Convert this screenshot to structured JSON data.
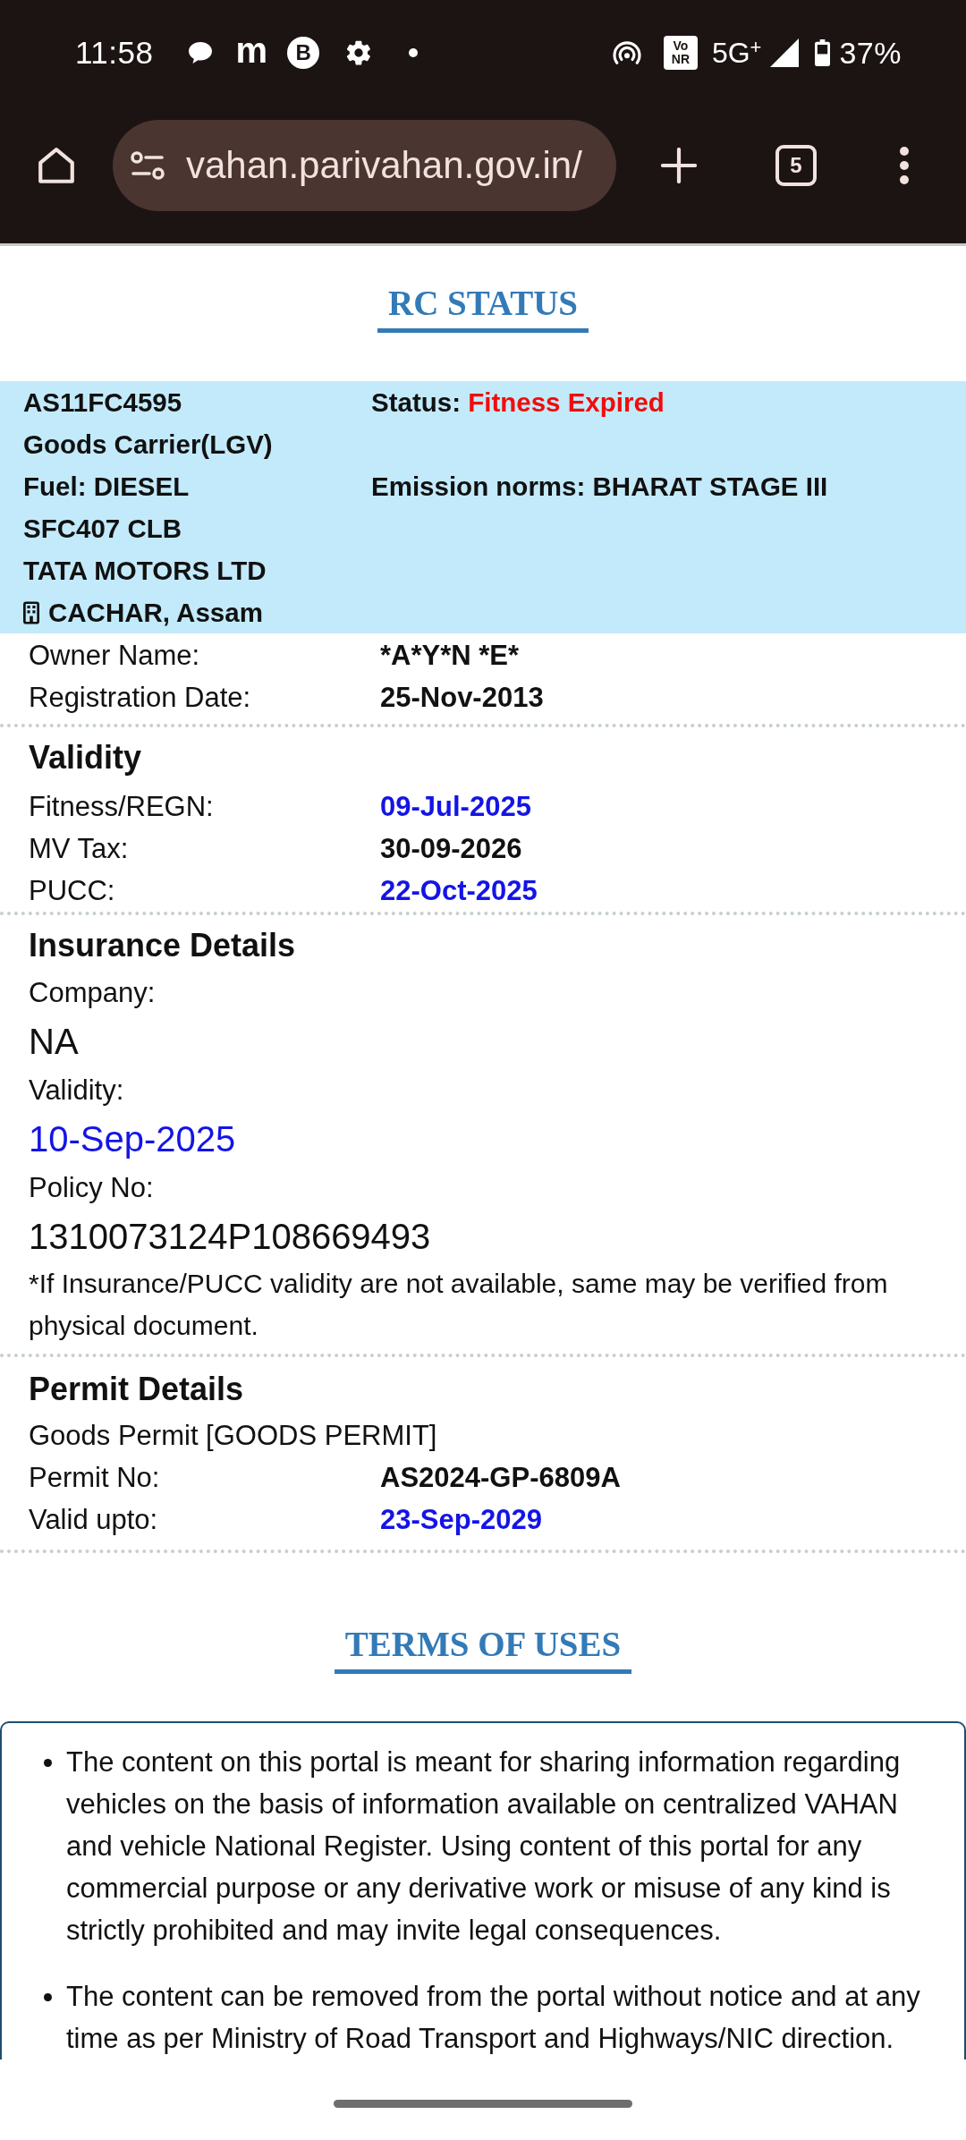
{
  "status_bar": {
    "time": "11:58",
    "notifications": [
      {
        "kind": "chat"
      },
      {
        "kind": "letter",
        "text": "m"
      },
      {
        "kind": "logo",
        "text": "B"
      },
      {
        "kind": "settings"
      },
      {
        "kind": "more"
      }
    ],
    "network_badge": [
      "Vo",
      "NR"
    ],
    "network": "5G$^{+}$",
    "battery": "37%"
  },
  "browser": {
    "url": "vahan.parivahan.gov.in/",
    "tab_count": "5"
  },
  "page_title": "RC STATUS",
  "vehicle_card": {
    "registration_no": "AS11FC4595",
    "status": {
      "label": "Status:",
      "value": "Fitness Expired",
      "alert": true
    },
    "vehicle_class": "Goods Carrier(LGV)",
    "fuel": "Fuel: DIESEL",
    "emission_norms": "Emission norms: BHARAT STAGE III",
    "model": "SFC407 CLB",
    "maker": "TATA MOTORS LTD",
    "registering_office": "CACHAR, Assam"
  },
  "owner_details": [
    {
      "label": "Owner Name:",
      "value": "*A*Y*N *E*"
    },
    {
      "label": "Registration Date:",
      "value": "25-Nov-2013"
    }
  ],
  "validity": {
    "heading": "Validity",
    "rows": [
      {
        "label": "Fitness/REGN:",
        "value": "09-Jul-2025",
        "highlighted": true
      },
      {
        "label": "MV Tax:",
        "value": "30-09-2026",
        "highlighted": false
      },
      {
        "label": "PUCC:",
        "value": "22-Oct-2025",
        "highlighted": true
      }
    ]
  },
  "insurance": {
    "heading": "Insurance Details",
    "fields": [
      {
        "label": "Company:",
        "value": "NA",
        "highlighted": false
      },
      {
        "label": "Validity:",
        "value": "10-Sep-2025",
        "highlighted": true
      },
      {
        "label": "Policy No:",
        "value": "1310073124P108669493",
        "highlighted": false
      }
    ],
    "note": "*If Insurance/PUCC validity are not available, same may be verified from physical document."
  },
  "permit": {
    "heading": "Permit Details",
    "permit_type": "Goods Permit [GOODS PERMIT]",
    "rows": [
      {
        "label": "Permit No:",
        "value": "AS2024-GP-6809A",
        "highlighted": false
      },
      {
        "label": "Valid upto:",
        "value": "23-Sep-2029",
        "highlighted": true
      }
    ]
  },
  "terms": {
    "heading": "TERMS OF USES",
    "items": [
      "The content on this portal is meant for sharing information regarding vehicles on the basis of information available on centralized VAHAN and vehicle National Register. Using content of this portal for any commercial purpose or any derivative work or misuse of any kind is strictly prohibited and may invite legal consequences.",
      "The content can be removed from the portal without notice and at any time as per Ministry of Road Transport and Highways/NIC direction."
    ]
  }
}
